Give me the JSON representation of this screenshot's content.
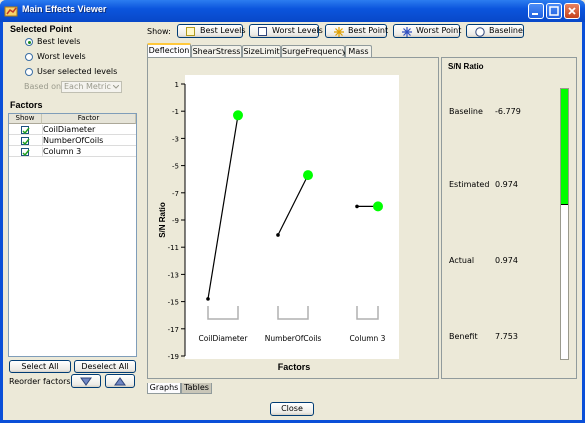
{
  "window": {
    "title": "Main Effects Viewer"
  },
  "selected_point": {
    "title": "Selected Point",
    "options": [
      "Best levels",
      "Worst levels",
      "User selected levels"
    ],
    "selected_index": 0,
    "based_on_label": "Based on:",
    "based_on_value": "Each Metric"
  },
  "factors": {
    "title": "Factors",
    "columns": [
      "Show",
      "Factor"
    ],
    "rows": [
      {
        "name": "CoilDiameter",
        "checked": true
      },
      {
        "name": "NumberOfCoils",
        "checked": true
      },
      {
        "name": "Column 3",
        "checked": true
      }
    ],
    "select_all": "Select All",
    "deselect_all": "Deselect All",
    "reorder_label": "Reorder factors:"
  },
  "toolbar": {
    "show_label": "Show:",
    "buttons": [
      "Best Levels",
      "Worst Levels",
      "Best Point",
      "Worst Point",
      "Baseline"
    ]
  },
  "tabs": [
    "Deflection",
    "ShearStress",
    "SizeLimit",
    "SurgeFrequency",
    "Mass"
  ],
  "active_tab": 0,
  "bottom_tabs": [
    "Graphs",
    "Tables"
  ],
  "sn_panel": {
    "title": "S/N Ratio",
    "rows": [
      {
        "label": "Baseline",
        "value": "-6.779"
      },
      {
        "label": "Estimated",
        "value": "0.974"
      },
      {
        "label": "Actual",
        "value": "0.974"
      },
      {
        "label": "Benefit",
        "value": "7.753"
      }
    ],
    "bar_fill_fraction": 0.43
  },
  "close_button": "Close",
  "colors": {
    "accent_green": "#00ff00",
    "title_blue": "#0b55dd"
  },
  "chart_data": {
    "type": "line",
    "xlabel": "Factors",
    "ylabel": "S/N Ratio",
    "ylim": [
      -19,
      1
    ],
    "yticks": [
      1,
      -1,
      -3,
      -5,
      -7,
      -9,
      -11,
      -13,
      -15,
      -17,
      -19
    ],
    "categories": [
      "CoilDiameter",
      "NumberOfCoils",
      "Column 3"
    ],
    "series": [
      {
        "factor": "CoilDiameter",
        "values": [
          -14.8,
          -1.3
        ]
      },
      {
        "factor": "NumberOfCoils",
        "values": [
          -10.1,
          -5.7
        ]
      },
      {
        "factor": "Column 3",
        "values": [
          -8.0,
          -8.0
        ]
      }
    ],
    "best_marker_color": "#00ff00"
  }
}
